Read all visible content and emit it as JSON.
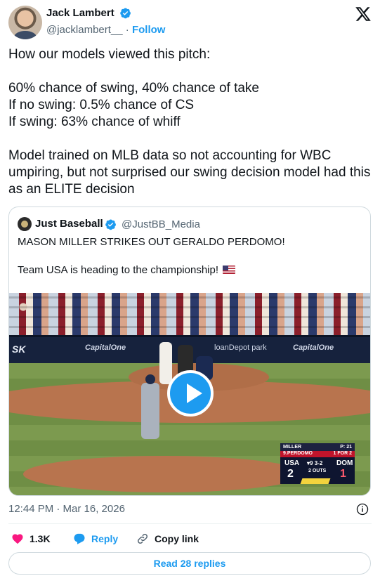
{
  "author": {
    "name": "Jack Lambert",
    "handle": "@jacklambert__",
    "separator": "·",
    "follow_label": "Follow"
  },
  "tweet": {
    "text": "How our models viewed this pitch:\n\n60% chance of swing, 40% chance of take\nIf no swing: 0.5% chance of CS\nIf swing: 63% chance of whiff\n\nModel trained on MLB data so not accounting for WBC umpiring, but not surprised our swing decision model had this as an ELITE decision"
  },
  "quote": {
    "name": "Just Baseball",
    "handle": "@JustBB_Media",
    "text_line1": "MASON MILLER STRIKES OUT GERALDO PERDOMO!",
    "text_line2": "Team USA is heading to the championship!",
    "flag_icon": "us-flag-icon",
    "video": {
      "ads": [
        "SK",
        "CapitalOne",
        "loanDepot park",
        "CapitalOne"
      ],
      "scorebug": {
        "pitcher": "MILLER",
        "pitch_count": "P: 21",
        "batter": "9.PERDOMO",
        "batter_line": "1 FOR 2",
        "away_team": "USA",
        "away_score": "2",
        "inning": "▾9",
        "count": "3-2",
        "outs": "2 OUTS",
        "home_team": "DOM",
        "home_score": "1"
      }
    }
  },
  "timestamp": "12:44 PM · Mar 16, 2026",
  "actions": {
    "likes": "1.3K",
    "reply": "Reply",
    "copy_link": "Copy link"
  },
  "read_replies": "Read 28 replies",
  "colors": {
    "accent": "#1d9bf0",
    "like": "#f91880",
    "secondary_text": "#536471"
  }
}
